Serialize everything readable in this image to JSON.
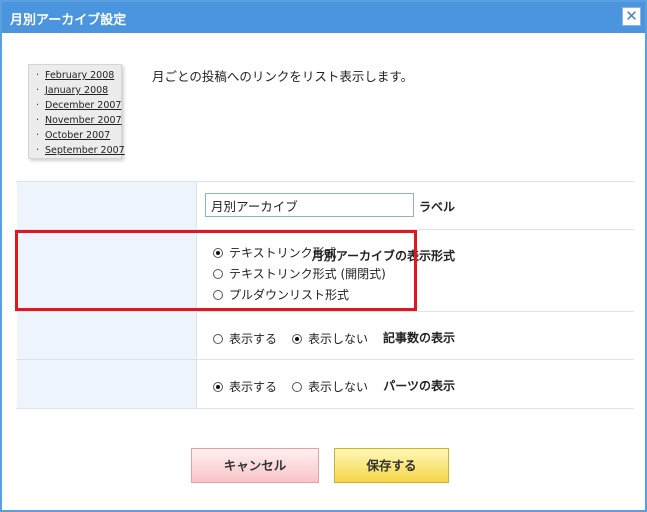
{
  "dialog": {
    "title": "月別アーカイブ設定",
    "close_symbol": "✕"
  },
  "preview": {
    "bullet": "·",
    "items": [
      "February 2008",
      "January 2008",
      "December 2007",
      "November 2007",
      "October 2007",
      "September 2007"
    ]
  },
  "description": "月ごとの投稿へのリンクをリスト表示します。",
  "form": {
    "label_row": {
      "label": "ラベル",
      "value": "月別アーカイブ"
    },
    "format_row": {
      "label": "月別アーカイブの表示形式",
      "options": [
        {
          "label": "テキストリンク形式",
          "checked": true
        },
        {
          "label": "テキストリンク形式 (開閉式)",
          "checked": false
        },
        {
          "label": "プルダウンリスト形式",
          "checked": false
        }
      ]
    },
    "count_row": {
      "label": "記事数の表示",
      "options": [
        {
          "label": "表示する",
          "checked": false
        },
        {
          "label": "表示しない",
          "checked": true
        }
      ]
    },
    "parts_row": {
      "label": "パーツの表示",
      "options": [
        {
          "label": "表示する",
          "checked": true
        },
        {
          "label": "表示しない",
          "checked": false
        }
      ]
    }
  },
  "buttons": {
    "cancel": "キャンセル",
    "save": "保存する"
  },
  "colors": {
    "titlebar": "#4a95de",
    "highlight": "#e0181e",
    "label_bg": "#edf4fc"
  }
}
